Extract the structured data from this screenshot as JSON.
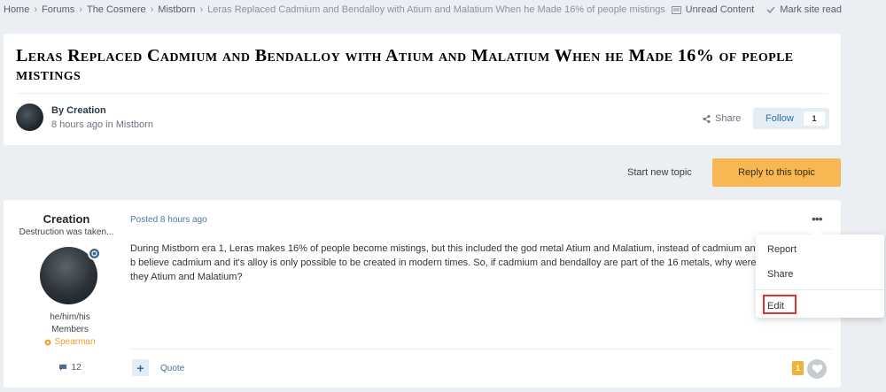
{
  "breadcrumb": {
    "items": [
      "Home",
      "Forums",
      "The Cosmere",
      "Mistborn",
      "Leras Replaced Cadmium and Bendalloy with Atium and Malatium When he Made 16% of people mistings"
    ]
  },
  "top_actions": {
    "unread": "Unread Content",
    "mark_read": "Mark site read"
  },
  "topic": {
    "title": "Leras Replaced Cadmium and Bendalloy with Atium and Malatium When he Made 16% of people mistings",
    "by": "By Creation",
    "meta": "8 hours ago in Mistborn",
    "share": "Share",
    "follow_label": "Follow",
    "follow_count": "1"
  },
  "actions": {
    "start_new_topic": "Start new topic",
    "reply": "Reply to this topic"
  },
  "post": {
    "author_name": "Creation",
    "author_title": "Destruction was taken...",
    "pronouns": "he/him/his",
    "group": "Members",
    "rank": "Spearman",
    "content_count": "12",
    "date": "Posted 8 hours ago",
    "body": "During Mistborn era 1, Leras makes 16% of people become mistings, but this included the god metal Atium and Malatium, instead of cadmium and b believe cadmium and it's alloy is only possible to be created in modern times. So, if cadmium and bendalloy are part of the 16 metals, why were they Atium and Malatium?",
    "more": "•••",
    "quote": "Quote",
    "plus": "+",
    "reaction_count": "1"
  },
  "menu": {
    "items": [
      "Report",
      "Share",
      "Edit"
    ]
  },
  "colors": {
    "accent_orange": "#f7b854",
    "link_blue": "#4a77a8",
    "highlight_red": "#dd3333"
  }
}
